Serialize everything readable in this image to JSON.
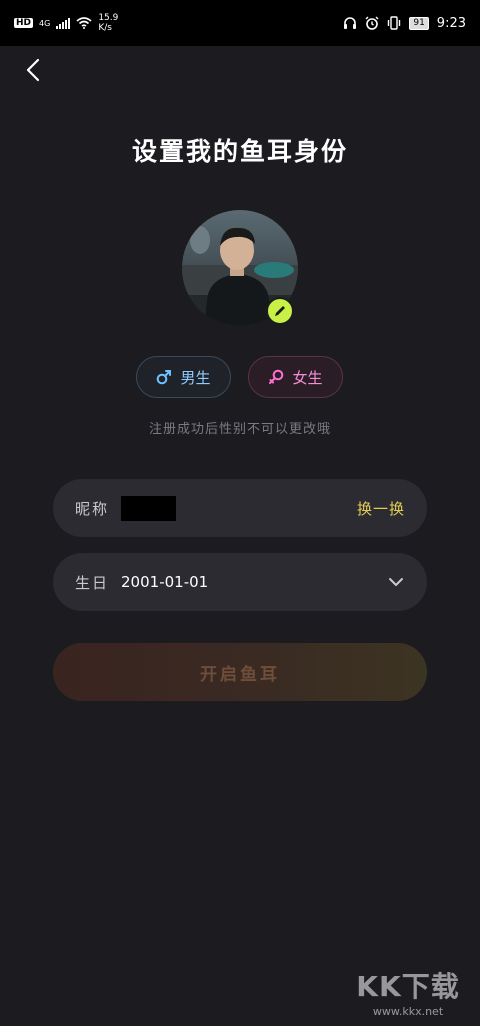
{
  "status_bar": {
    "hd": "HD",
    "network": "4G",
    "speed_value": "15.9",
    "speed_unit": "K/s",
    "battery": "91",
    "time": "9:23"
  },
  "header": {
    "back_icon": "chevron-left-icon",
    "title": "设置我的鱼耳身份"
  },
  "avatar": {
    "edit_icon": "pencil-icon"
  },
  "gender": {
    "male_label": "男生",
    "male_icon": "male-symbol-icon",
    "female_label": "女生",
    "female_icon": "female-symbol-icon",
    "hint": "注册成功后性别不可以更改哦"
  },
  "form": {
    "nickname_label": "昵称",
    "swap_label": "换一换",
    "birthday_label": "生日",
    "birthday_value": "2001-01-01",
    "dropdown_icon": "chevron-down-icon"
  },
  "submit_label": "开启鱼耳",
  "watermark": {
    "logo": "KK下载",
    "url": "www.kkx.net"
  },
  "colors": {
    "background": "#1b1b20",
    "field_bg": "#2b2b31",
    "accent_yellow": "#e4cd55",
    "male_blue": "#8ecbff",
    "female_pink": "#f58ed6",
    "edit_badge": "#c8f046"
  }
}
